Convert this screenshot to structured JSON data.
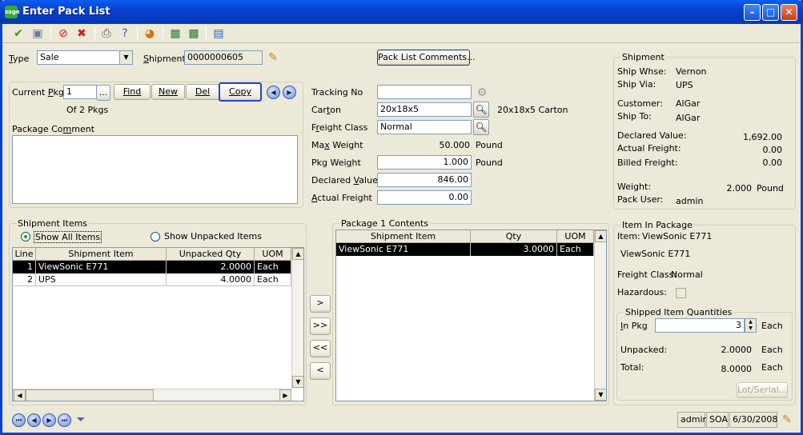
{
  "window": {
    "title": "Enter Pack List",
    "app_icon": "sage"
  },
  "header": {
    "type_label": "Type",
    "type_value": "Sale",
    "shipment_label": "Shipment",
    "shipment_value": "0000000605",
    "pack_list_comments": "Pack List Comments..."
  },
  "package": {
    "current_pkg_label": "Current Pkg",
    "current_pkg_value": "1",
    "ellipsis": "...",
    "find": "Find",
    "new": "New",
    "del": "Del",
    "copy": "Copy",
    "of_pkgs": "Of 2 Pkgs",
    "comment_label": "Package Comment",
    "comment_value": ""
  },
  "details": {
    "tracking_label": "Tracking No",
    "tracking_value": "",
    "carton_label": "Carton",
    "carton_value": "20x18x5",
    "carton_desc": "20x18x5 Carton",
    "freight_class_label": "Freight Class",
    "freight_class_value": "Normal",
    "max_weight_label": "Max Weight",
    "max_weight_value": "50.000",
    "max_weight_unit": "Pound",
    "pkg_weight_label": "Pkg Weight",
    "pkg_weight_value": "1.000",
    "pkg_weight_unit": "Pound",
    "declared_label": "Declared Value",
    "declared_value": "846.00",
    "actual_freight_label": "Actual Freight",
    "actual_freight_value": "0.00"
  },
  "shipment": {
    "title": "Shipment",
    "ship_whse_label": "Ship Whse:",
    "ship_whse": "Vernon",
    "ship_via_label": "Ship Via:",
    "ship_via": "UPS",
    "customer_label": "Customer:",
    "customer": "AlGar",
    "ship_to_label": "Ship To:",
    "ship_to": "AlGar",
    "declared_label": "Declared Value:",
    "declared": "1,692.00",
    "actual_freight_label": "Actual Freight:",
    "actual_freight": "0.00",
    "billed_freight_label": "Billed Freight:",
    "billed_freight": "0.00",
    "weight_label": "Weight:",
    "weight": "2.000",
    "weight_unit": "Pound",
    "pack_user_label": "Pack User:",
    "pack_user": "admin"
  },
  "shipment_items": {
    "title": "Shipment Items",
    "show_all": "Show All Items",
    "show_unpacked": "Show Unpacked Items",
    "columns": [
      "Line",
      "Shipment Item",
      "Unpacked Qty",
      "UOM"
    ],
    "rows": [
      [
        "1",
        "ViewSonic E771",
        "2.0000",
        "Each"
      ],
      [
        "2",
        "UPS",
        "4.0000",
        "Each"
      ]
    ]
  },
  "transfer": {
    "add": ">",
    "add_all": ">>",
    "remove_all": "<<",
    "remove": "<"
  },
  "contents": {
    "title": "Package 1 Contents",
    "columns": [
      "Shipment Item",
      "Qty",
      "UOM"
    ],
    "rows": [
      [
        "ViewSonic E771",
        "3.0000",
        "Each"
      ]
    ]
  },
  "item_in_package": {
    "title": "Item In Package",
    "item_label": "Item:",
    "item": "ViewSonic E771",
    "desc": "ViewSonic E771",
    "freight_class_label": "Freight Class:",
    "freight_class": "Normal",
    "hazardous_label": "Hazardous:",
    "shipped_title": "Shipped Item Quantities",
    "in_pkg_label": "In Pkg",
    "in_pkg_value": "3",
    "in_pkg_uom": "Each",
    "unpacked_label": "Unpacked:",
    "unpacked": "2.0000",
    "unpacked_uom": "Each",
    "total_label": "Total:",
    "total": "8.0000",
    "total_uom": "Each",
    "lot_serial": "Lot/Serial..."
  },
  "statusbar": {
    "user": "admin",
    "company": "SOA",
    "date": "6/30/2008"
  }
}
